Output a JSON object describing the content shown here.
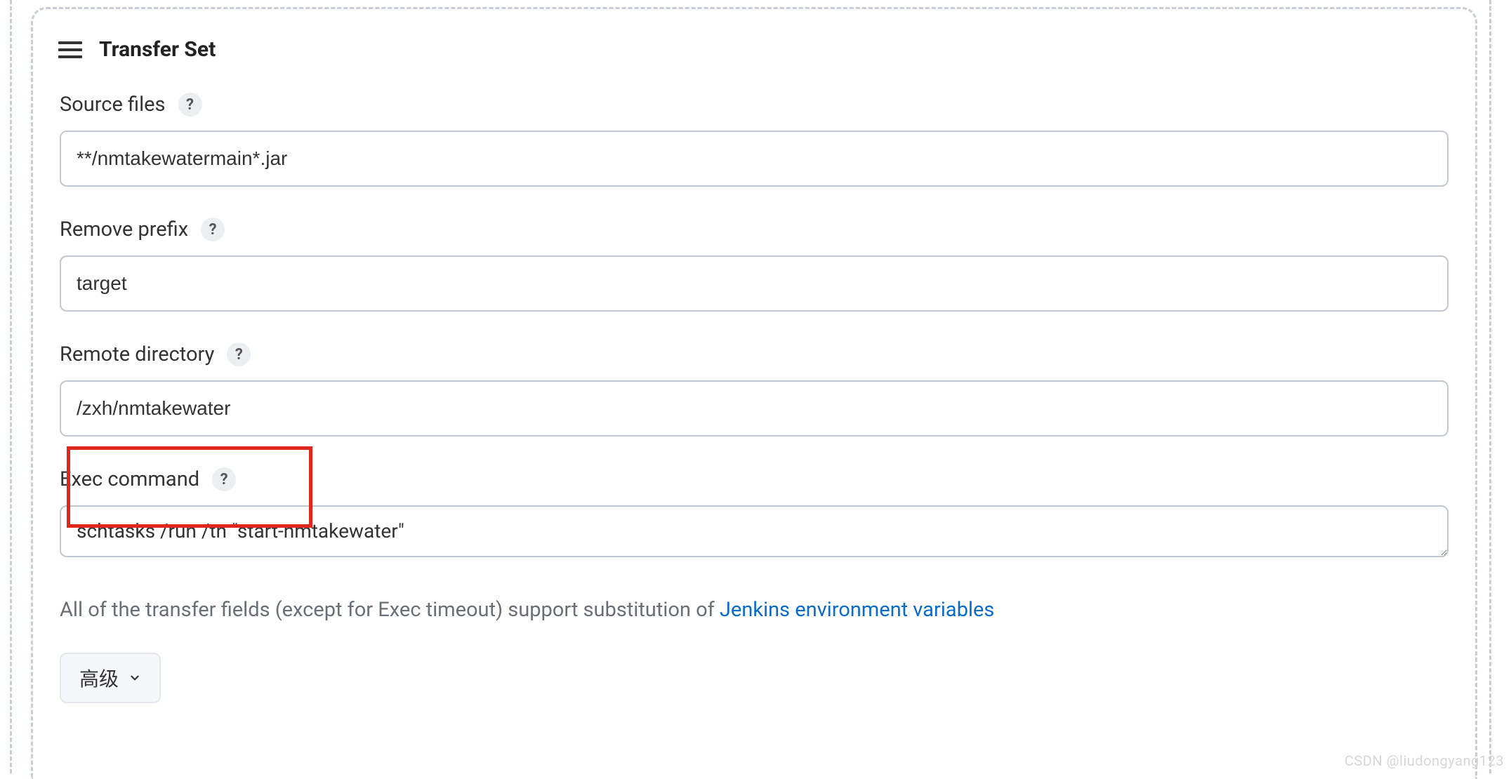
{
  "section": {
    "title": "Transfer Set"
  },
  "fields": {
    "source_files": {
      "label": "Source files",
      "value": "**/nmtakewatermain*.jar"
    },
    "remove_prefix": {
      "label": "Remove prefix",
      "value": "target"
    },
    "remote_directory": {
      "label": "Remote directory",
      "value": "/zxh/nmtakewater"
    },
    "exec_command": {
      "label": "Exec command",
      "value": "schtasks /run /tn \"start-nmtakewater\""
    }
  },
  "hint": {
    "prefix": "All of the transfer fields (except for Exec timeout) support substitution of ",
    "link": "Jenkins environment variables"
  },
  "advanced_button": {
    "label": "高级"
  },
  "help_glyph": "?",
  "watermark": "CSDN @liudongyang123"
}
